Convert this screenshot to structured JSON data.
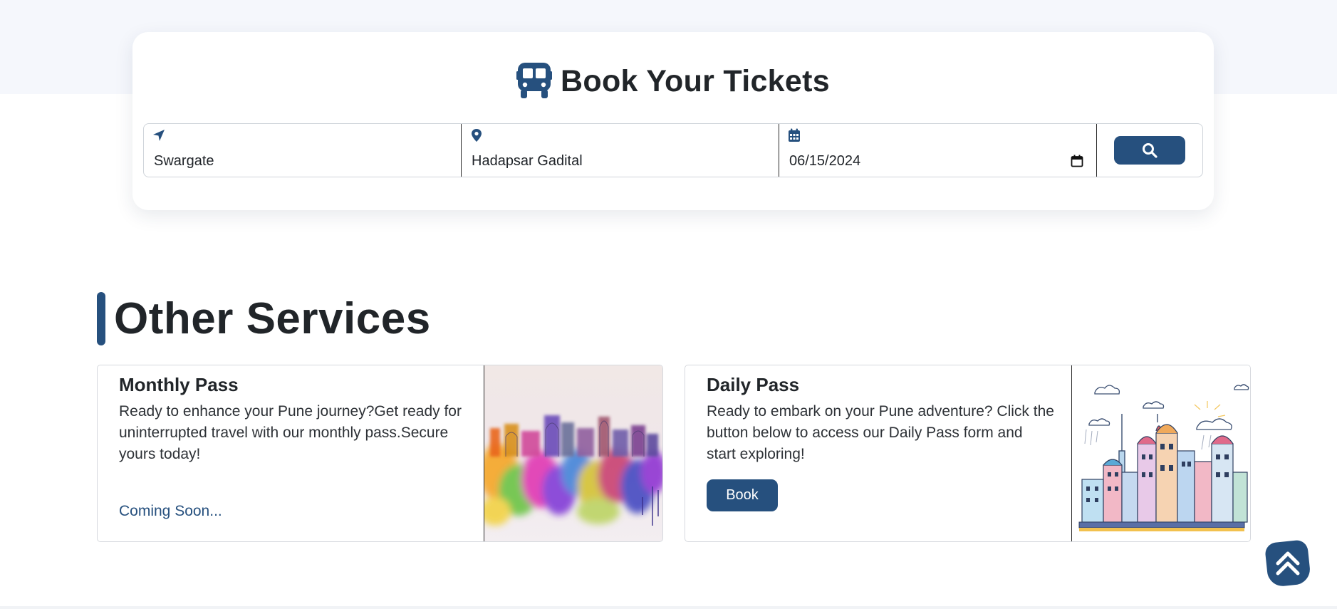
{
  "booking": {
    "title": "Book Your Tickets",
    "title_icon": "bus-icon",
    "from": {
      "icon": "location-arrow-icon",
      "value": "Swargate"
    },
    "to": {
      "icon": "map-pin-icon",
      "value": "Hadapsar Gadital"
    },
    "date": {
      "icon": "calendar-icon",
      "value": "06/15/2024"
    },
    "search_icon": "search-icon"
  },
  "services": {
    "heading": "Other Services",
    "cards": [
      {
        "title": "Monthly Pass",
        "description": "Ready to enhance your Pune journey?Get ready for uninterrupted travel with our monthly pass.Secure yours today!",
        "status": "Coming Soon...",
        "image": "watercolor-pune-skyline-image"
      },
      {
        "title": "Daily Pass",
        "description": "Ready to embark on your Pune adventure? Click the button below to access our Daily Pass form and start exploring!",
        "button_label": "Book",
        "image": "illustrated-city-skyline-image"
      }
    ]
  },
  "scroll_top_icon": "chevron-double-up-icon",
  "colors": {
    "primary": "#26507e",
    "heading": "#212529",
    "top_band": "#f5f7fc"
  }
}
